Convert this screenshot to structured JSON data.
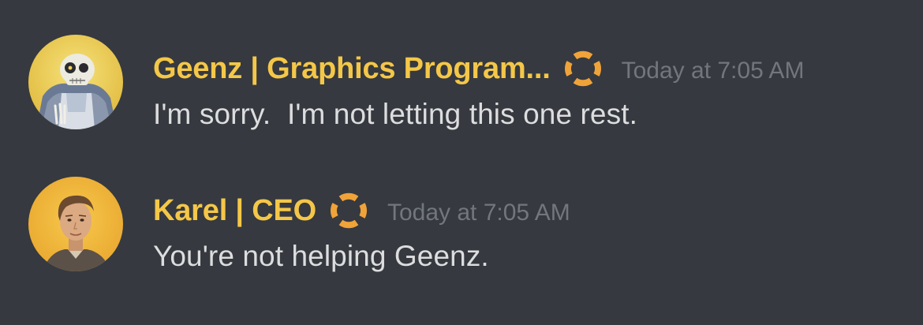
{
  "messages": [
    {
      "username": "Geenz | Graphics Program...",
      "timestamp": "Today at 7:05 AM",
      "content": "I'm sorry.  I'm not letting this one rest.",
      "role_icon": "overwatch-emblem-icon",
      "avatar": "skeleton-character-avatar"
    },
    {
      "username": "Karel | CEO",
      "timestamp": "Today at 7:05 AM",
      "content": "You're not helping Geenz.",
      "role_icon": "overwatch-emblem-icon",
      "avatar": "man-portrait-avatar"
    }
  ],
  "colors": {
    "background": "#36393f",
    "username": "#f4c748",
    "timestamp": "#72767d",
    "message_text": "#dcddde",
    "role_icon": "#f0a339"
  }
}
